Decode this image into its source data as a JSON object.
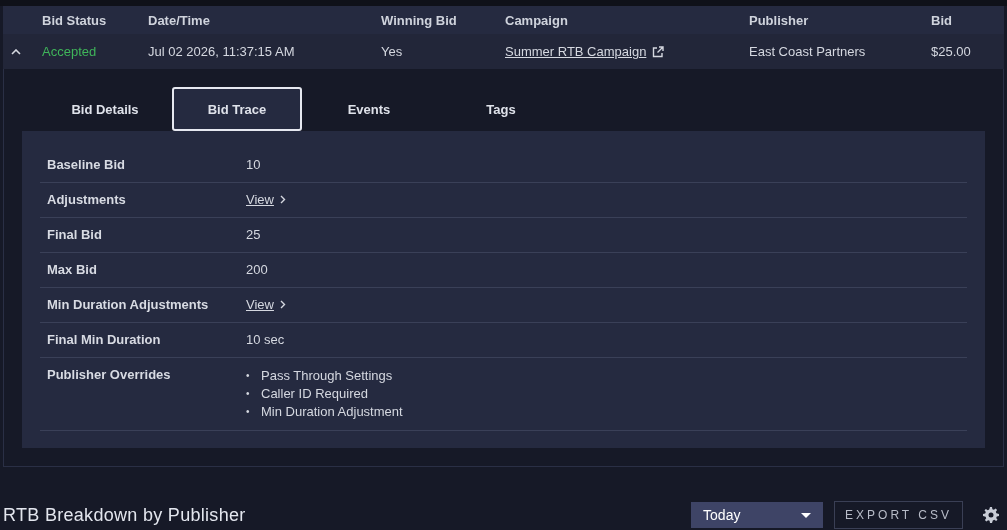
{
  "table": {
    "columns": [
      "Bid Status",
      "Date/Time",
      "Winning Bid",
      "Campaign",
      "Publisher",
      "Bid"
    ],
    "rows": [
      {
        "expanded": true,
        "status": "Accepted",
        "color": "#3fb45a",
        "datetime": "Jul 02 2026, 11:37:15 AM",
        "winning_bid": "Yes",
        "campaign": "Summer RTB Campaign",
        "publisher": "East Coast Partners",
        "bid": "$25.00",
        "detail": {
          "tabs": [
            {
              "label": "Bid Details",
              "selected": false
            },
            {
              "label": "Bid Trace",
              "selected": true
            },
            {
              "label": "Events",
              "selected": false
            },
            {
              "label": "Tags",
              "selected": false
            }
          ],
          "fields": [
            {
              "kind": "text",
              "label": "Baseline Bid",
              "value": "10"
            },
            {
              "kind": "link",
              "label": "Adjustments",
              "value": "View"
            },
            {
              "kind": "text",
              "label": "Final Bid",
              "value": "25"
            },
            {
              "kind": "text",
              "label": "Max Bid",
              "value": "200"
            },
            {
              "kind": "link",
              "label": "Min Duration Adjustments",
              "value": "View"
            },
            {
              "kind": "text",
              "label": "Final Min Duration",
              "value": "10 sec"
            },
            {
              "kind": "list",
              "label": "Publisher Overrides",
              "items": [
                {
                  "bullet": "•",
                  "text": "Pass Through Settings"
                },
                {
                  "bullet": "•",
                  "text": "Caller ID Required"
                },
                {
                  "bullet": "•",
                  "text": "Min Duration Adjustment"
                }
              ]
            }
          ]
        }
      }
    ]
  },
  "section": {
    "title": "RTB Breakdown by Publisher",
    "range": {
      "value": "Today"
    },
    "export_button": "EXPORT CSV"
  }
}
